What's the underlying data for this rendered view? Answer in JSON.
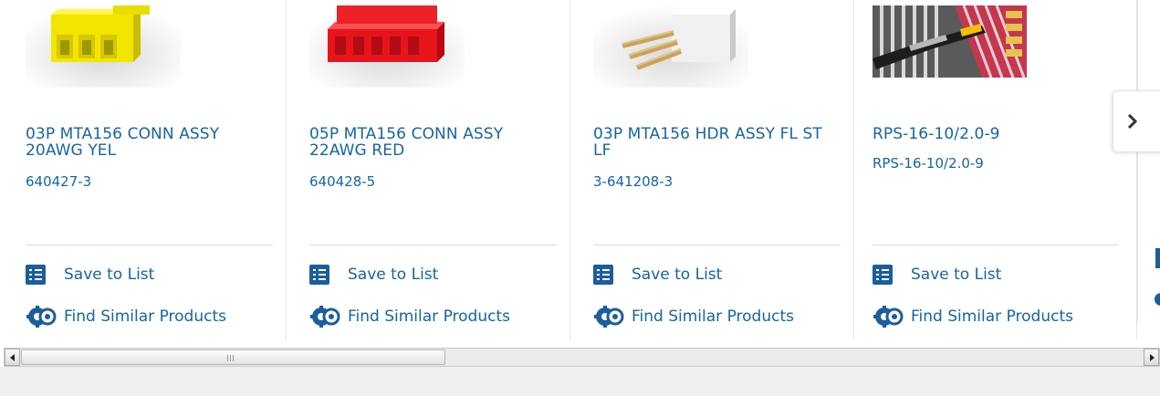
{
  "products": [
    {
      "title": "03P MTA156 CONN ASSY 20AWG YEL",
      "part_number": "640427-3",
      "save_label": "Save to List",
      "find_label": "Find Similar Products",
      "image": "yellow-connector-image"
    },
    {
      "title": "05P MTA156 CONN ASSY 22AWG RED",
      "part_number": "640428-5",
      "save_label": "Save to List",
      "find_label": "Find Similar Products",
      "image": "red-connector-image"
    },
    {
      "title": "03P MTA156 HDR ASSY FL ST LF",
      "part_number": "3-641208-3",
      "save_label": "Save to List",
      "find_label": "Find Similar Products",
      "image": "white-header-image"
    },
    {
      "title": "RPS-16-10/2.0-9",
      "part_number": "RPS-16-10/2.0-9",
      "save_label": "Save to List",
      "find_label": "Find Similar Products",
      "image": "cable-marker-image"
    }
  ],
  "carousel": {
    "next_icon": "chevron-right-icon"
  },
  "scrollbar": {
    "left_icon": "scroll-left-arrow-icon",
    "right_icon": "scroll-right-arrow-icon"
  },
  "colors": {
    "link": "#1565a3",
    "icon_blue": "#1b5e9d",
    "divider": "#dcdcdc"
  }
}
